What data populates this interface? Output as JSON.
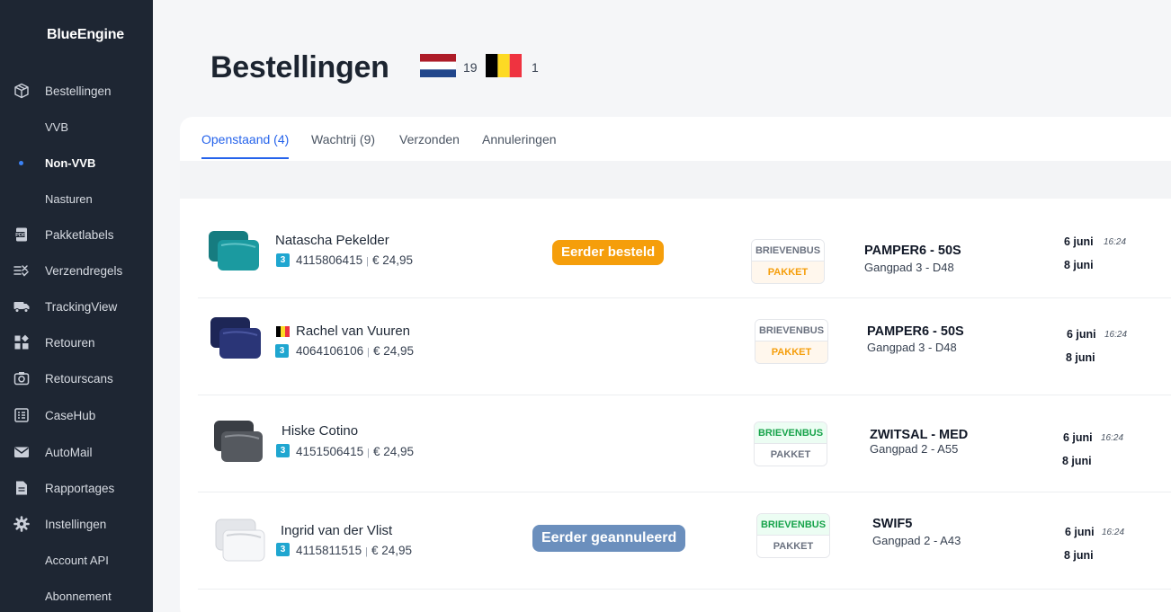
{
  "app": {
    "brand": "BlueEngine"
  },
  "sidebar": {
    "items": [
      {
        "label": "Bestellingen",
        "icon": "box-icon"
      },
      {
        "label": "VVB",
        "sub": true
      },
      {
        "label": "Non-VVB",
        "sub": true,
        "active": true
      },
      {
        "label": "Nasturen",
        "sub": true
      },
      {
        "label": "Pakketlabels",
        "icon": "pdf-icon"
      },
      {
        "label": "Verzendregels",
        "icon": "rules-icon"
      },
      {
        "label": "TrackingView",
        "icon": "truck-icon"
      },
      {
        "label": "Retouren",
        "icon": "returns-icon"
      },
      {
        "label": "Retourscans",
        "icon": "camera-icon"
      },
      {
        "label": "CaseHub",
        "icon": "casehub-icon"
      },
      {
        "label": "AutoMail",
        "icon": "mail-icon"
      },
      {
        "label": "Rapportages",
        "icon": "report-icon"
      },
      {
        "label": "Instellingen",
        "icon": "gear-icon"
      },
      {
        "label": "Account API",
        "sub": true
      },
      {
        "label": "Abonnement",
        "sub": true
      }
    ]
  },
  "header": {
    "title": "Bestellingen",
    "countries": [
      {
        "flag": "nl-flag-icon",
        "count": "19"
      },
      {
        "flag": "be-flag-icon",
        "count": "1"
      }
    ]
  },
  "tabs": [
    {
      "label": "Openstaand (4)",
      "active": true
    },
    {
      "label": "Wachtrij (9)"
    },
    {
      "label": "Verzonden"
    },
    {
      "label": "Annuleringen"
    }
  ],
  "orders": [
    {
      "name": "Natascha Pekelder",
      "qty": "3",
      "order_no": "4115806415",
      "price": "€ 24,95",
      "status": "Eerder besteld",
      "shipping_top": "BRIEVENBUS",
      "shipping_bottom": "PAKKET",
      "sku": "PAMPER6 - 50S",
      "aisle": "Gangpad 3 - D48",
      "date1": "6 juni",
      "time": "16:24",
      "date2": "8 juni",
      "color": "#1b8f94"
    },
    {
      "name": "Rachel van Vuuren",
      "country_flag": "be-flag-icon",
      "qty": "3",
      "order_no": "4064106106",
      "price": "€ 24,95",
      "shipping_top": "BRIEVENBUS",
      "shipping_bottom": "PAKKET",
      "sku": "PAMPER6 - 50S",
      "aisle": "Gangpad 3 - D48",
      "date1": "6 juni",
      "time": "16:24",
      "date2": "8 juni",
      "color": "#26306b"
    },
    {
      "name": "Hiske Cotino",
      "qty": "3",
      "order_no": "4151506415",
      "price": "€ 24,95",
      "shipping_top": "BRIEVENBUS",
      "shipping_bottom": "PAKKET",
      "sku": "ZWITSAL - MED",
      "aisle": "Gangpad 2 - A55",
      "date1": "6 juni",
      "time": "16:24",
      "date2": "8 juni",
      "color": "#4a4f57"
    },
    {
      "name": "Ingrid van der Vlist",
      "qty": "3",
      "order_no": "4115811515",
      "price": "€ 24,95",
      "status": "Eerder geannuleerd",
      "shipping_top": "BRIEVENBUS",
      "shipping_bottom": "PAKKET",
      "sku": "SWIF5",
      "aisle": "Gangpad 2 - A43",
      "date1": "6 juni",
      "time": "16:24",
      "date2": "8 juni",
      "color": "#eef0f3"
    }
  ]
}
